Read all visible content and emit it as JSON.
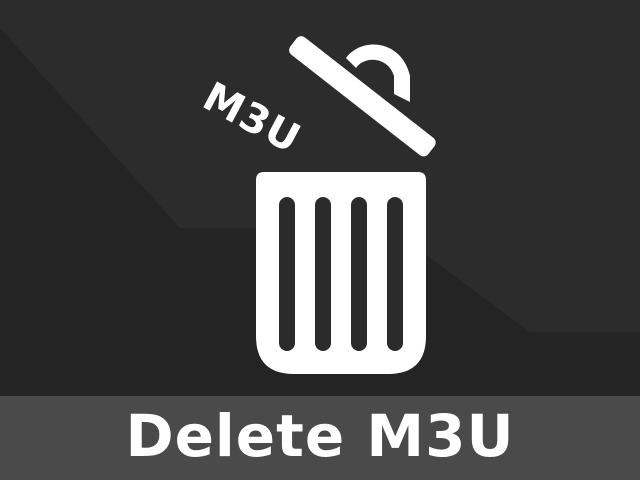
{
  "icon": {
    "name": "trash-can-icon",
    "lid_label": "M3U"
  },
  "footer": {
    "title": "Delete M3U"
  },
  "colors": {
    "background": "#2b2b2b",
    "background_shadow": "#242424",
    "footer_band": "#4a4a4a",
    "foreground": "#ffffff"
  }
}
